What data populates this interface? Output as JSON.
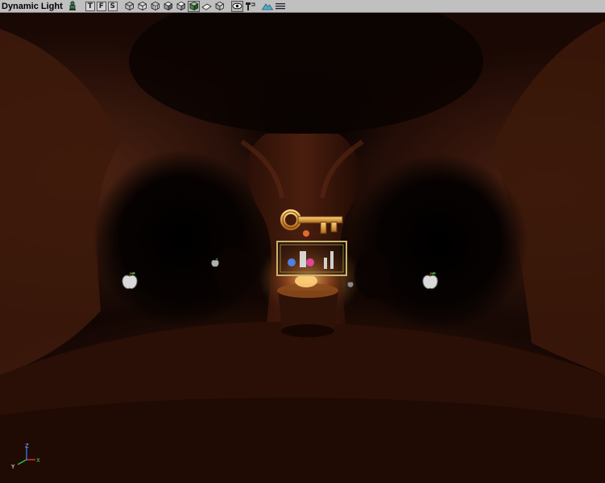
{
  "toolbar": {
    "mode_label": "Dynamic Light",
    "view_buttons": [
      "T",
      "F",
      "S"
    ]
  },
  "viewport": {
    "gizmo_axes": {
      "z": "Z",
      "y": "Y",
      "x": "X"
    }
  },
  "colors": {
    "toolbar_bg": "#c0c0c0",
    "cave_rock": "#4e2313",
    "key_gold": "#e7a640",
    "light_glow": "#ffb052"
  }
}
